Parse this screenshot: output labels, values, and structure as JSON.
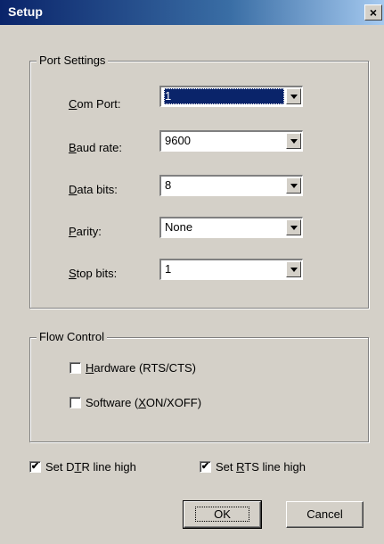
{
  "window": {
    "title": "Setup",
    "close_glyph": "×"
  },
  "port_settings": {
    "legend": "Port Settings",
    "com_port": {
      "label_u": "C",
      "label_rest": "om Port:",
      "value": "1"
    },
    "baud_rate": {
      "label_u": "B",
      "label_rest": "aud rate:",
      "value": "9600"
    },
    "data_bits": {
      "label_u": "D",
      "label_rest": "ata bits:",
      "value": "8"
    },
    "parity": {
      "label_u": "P",
      "label_rest": "arity:",
      "value": "None"
    },
    "stop_bits": {
      "label_u": "S",
      "label_rest": "top bits:",
      "value": "1"
    }
  },
  "flow_control": {
    "legend": "Flow Control",
    "hardware": {
      "label_u": "H",
      "label_rest": "ardware (RTS/CTS)",
      "checked": false
    },
    "software": {
      "label_pre": "Software (",
      "label_u": "X",
      "label_rest": "ON/XOFF)",
      "checked": false
    }
  },
  "dtr": {
    "label_pre": "Set D",
    "label_u": "T",
    "label_rest": "R line high",
    "checked": true,
    "mark": "✔"
  },
  "rts": {
    "label_pre": "Set ",
    "label_u": "R",
    "label_rest": "TS line high",
    "checked": true,
    "mark": "✔"
  },
  "buttons": {
    "ok": "OK",
    "cancel": "Cancel"
  }
}
